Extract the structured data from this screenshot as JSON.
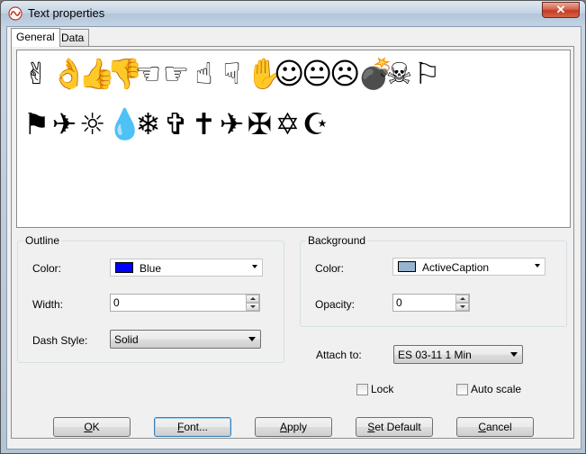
{
  "window": {
    "title": "Text properties",
    "close_glyph": "✕"
  },
  "tabs": [
    {
      "label": "General",
      "active": true
    },
    {
      "label": "Data",
      "active": false
    }
  ],
  "symbols": {
    "row1": [
      "✌",
      "👌",
      "👍",
      "👎",
      "☜",
      "☞",
      "☝",
      "☟",
      "✋",
      "☺",
      "😐",
      "☹",
      "💣",
      "☠",
      "⚐"
    ],
    "row2": [
      "⚑",
      "✈",
      "☼",
      "💧",
      "❄",
      "✞",
      "✝",
      "✈",
      "✠",
      "✡",
      "☪"
    ]
  },
  "outline": {
    "legend": "Outline",
    "color_label": "Color:",
    "color_value": "Blue",
    "color_swatch": "#0000ff",
    "width_label": "Width:",
    "width_value": "0",
    "dash_label": "Dash Style:",
    "dash_value": "Solid"
  },
  "background": {
    "legend": "Background",
    "color_label": "Color:",
    "color_value": "ActiveCaption",
    "color_swatch": "#99b4d1",
    "opacity_label": "Opacity:",
    "opacity_value": "0"
  },
  "attach": {
    "label": "Attach to:",
    "value": "ES 03-11 1 Min"
  },
  "options": {
    "lock_label": "Lock",
    "lock_checked": false,
    "autoscale_label": "Auto scale",
    "autoscale_checked": false
  },
  "buttons": {
    "ok_accel": "O",
    "ok_rest": "K",
    "font_accel": "F",
    "font_rest": "ont...",
    "apply_accel": "A",
    "apply_rest": "pply",
    "setdefault_accel": "S",
    "setdefault_rest": "et Default",
    "cancel_accel": "C",
    "cancel_rest": "ancel"
  }
}
